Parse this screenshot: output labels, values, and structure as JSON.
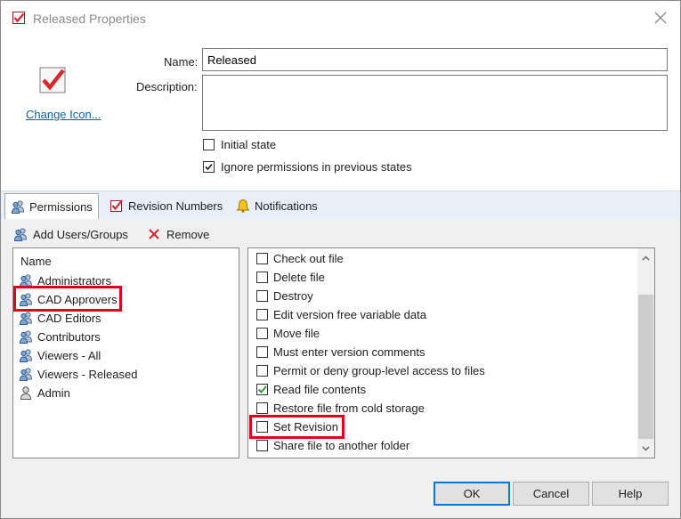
{
  "window": {
    "title": "Released Properties",
    "close_glyph": "✕"
  },
  "header": {
    "change_icon_link": "Change Icon...",
    "name_label": "Name:",
    "name_value": "Released",
    "description_label": "Description:",
    "description_value": "",
    "initial_state": {
      "label": "Initial state",
      "checked": false
    },
    "ignore_permissions": {
      "label": "Ignore permissions in previous states",
      "checked": true
    }
  },
  "tabs": [
    {
      "label": "Permissions",
      "icon": "users-icon",
      "active": true
    },
    {
      "label": "Revision Numbers",
      "icon": "checkmark-icon",
      "active": false
    },
    {
      "label": "Notifications",
      "icon": "bell-icon",
      "active": false
    }
  ],
  "toolbar": {
    "add_label": "Add Users/Groups",
    "remove_label": "Remove"
  },
  "users": {
    "header": "Name",
    "items": [
      {
        "label": "Administrators",
        "icon": "group-icon"
      },
      {
        "label": "CAD Approvers",
        "icon": "group-icon",
        "highlighted": true
      },
      {
        "label": "CAD Editors",
        "icon": "group-icon"
      },
      {
        "label": "Contributors",
        "icon": "group-icon"
      },
      {
        "label": "Viewers - All",
        "icon": "group-icon"
      },
      {
        "label": "Viewers - Released",
        "icon": "group-icon"
      },
      {
        "label": "Admin",
        "icon": "user-icon"
      }
    ]
  },
  "permissions": {
    "items": [
      {
        "label": "Check out file",
        "checked": false
      },
      {
        "label": "Delete file",
        "checked": false
      },
      {
        "label": "Destroy",
        "checked": false
      },
      {
        "label": "Edit version free variable data",
        "checked": false
      },
      {
        "label": "Move file",
        "checked": false
      },
      {
        "label": "Must enter version comments",
        "checked": false
      },
      {
        "label": "Permit or deny group-level access to files",
        "checked": false
      },
      {
        "label": "Read file contents",
        "checked": true
      },
      {
        "label": "Restore file from cold storage",
        "checked": false
      },
      {
        "label": "Set Revision",
        "checked": false,
        "highlighted": true
      },
      {
        "label": "Share file to another folder",
        "checked": false
      }
    ]
  },
  "buttons": {
    "ok": "OK",
    "cancel": "Cancel",
    "help": "Help"
  },
  "colors": {
    "highlight": "#e0001b",
    "check_green": "#2e9b3c",
    "icon_red": "#d9272e",
    "link": "#0b61b5",
    "tabstrip": "#e9eff8"
  }
}
